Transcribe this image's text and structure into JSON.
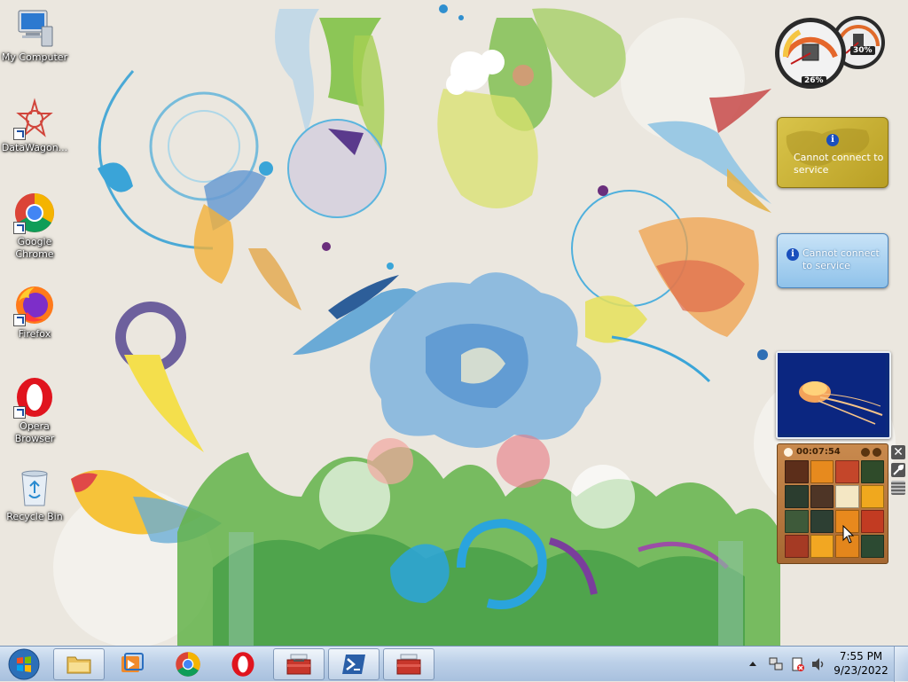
{
  "desktop_icons": [
    {
      "label": "My Computer",
      "icon": "computer-icon"
    },
    {
      "label": "DataWagon...",
      "icon": "datawagon-icon",
      "shortcut": true
    },
    {
      "label": "Google\nChrome",
      "icon": "chrome-icon",
      "shortcut": true
    },
    {
      "label": "Firefox",
      "icon": "firefox-icon",
      "shortcut": true
    },
    {
      "label": "Opera\nBrowser",
      "icon": "opera-icon",
      "shortcut": true
    },
    {
      "label": "Recycle Bin",
      "icon": "recycle-bin-icon"
    }
  ],
  "gadgets": {
    "cpu_meter": {
      "cpu": "26%",
      "memory": "30%"
    },
    "weather_gold": {
      "message": "Cannot connect\nto service",
      "info": "i"
    },
    "weather_blue": {
      "message": "Cannot connect\nto service",
      "info": "i"
    },
    "slideshow": {
      "subject": "jellyfish"
    },
    "puzzle": {
      "timer": "00:07:54"
    }
  },
  "taskbar": {
    "items": [
      {
        "name": "file-explorer",
        "icon": "folder-icon",
        "state": "running"
      },
      {
        "name": "media-player",
        "icon": "media-player-icon",
        "state": "pinned"
      },
      {
        "name": "chrome",
        "icon": "chrome-icon",
        "state": "pinned"
      },
      {
        "name": "opera",
        "icon": "opera-icon",
        "state": "pinned"
      },
      {
        "name": "toolbox-1",
        "icon": "toolbox-icon",
        "state": "running"
      },
      {
        "name": "powershell",
        "icon": "powershell-icon",
        "state": "running"
      },
      {
        "name": "toolbox-2",
        "icon": "toolbox-icon",
        "state": "running"
      }
    ]
  },
  "tray": {
    "icons": [
      "show-hidden-icons-icon",
      "network-icon",
      "action-center-icon",
      "volume-icon"
    ],
    "time": "7:55 PM",
    "date": "9/23/2022"
  }
}
